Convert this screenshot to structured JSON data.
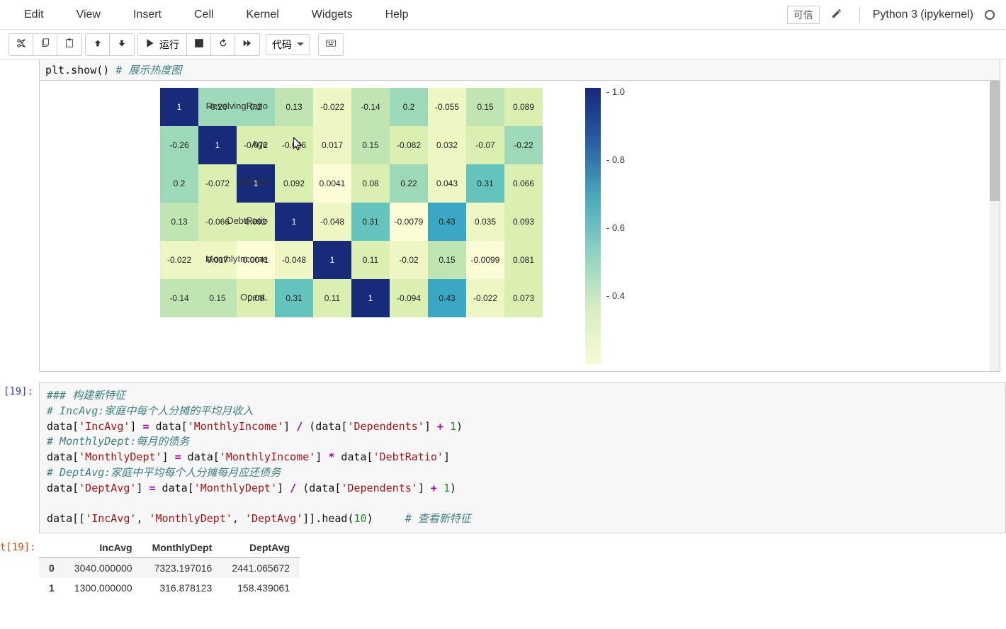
{
  "menu": {
    "edit": "Edit",
    "view": "View",
    "insert": "Insert",
    "cell": "Cell",
    "kernel": "Kernel",
    "widgets": "Widgets",
    "help": "Help",
    "trusted": "可信",
    "kernel_name": "Python 3 (ipykernel)"
  },
  "toolbar": {
    "run_label": "运行",
    "celltype_selected": "代码"
  },
  "top_cell": {
    "code_visible": "plt.show()  # 展示热度图",
    "show_fn": "plt.show",
    "parens": "()",
    "comment": "# 展示热度图"
  },
  "chart_data": {
    "type": "heatmap",
    "title": "",
    "xlabel": "",
    "ylabel": "",
    "cbar_range": [
      0,
      1
    ],
    "cbar_ticks": [
      1.0,
      0.8,
      0.6,
      0.4
    ],
    "row_labels": [
      "RevolvingRatio",
      "Age",
      "30-59D",
      "DebtRatio",
      "MonthlyIncome",
      "OpenL"
    ],
    "matrix": [
      [
        1,
        -0.26,
        0.2,
        0.13,
        -0.022,
        -0.14,
        0.2,
        -0.055,
        0.15,
        0.089
      ],
      [
        -0.26,
        1,
        -0.072,
        -0.066,
        0.017,
        0.15,
        -0.082,
        0.032,
        -0.07,
        -0.22
      ],
      [
        0.2,
        -0.072,
        1,
        0.092,
        0.0041,
        0.08,
        0.22,
        0.043,
        0.31,
        0.066
      ],
      [
        0.13,
        -0.066,
        0.092,
        1,
        -0.048,
        0.31,
        -0.0079,
        0.43,
        0.035,
        0.093
      ],
      [
        -0.022,
        0.017,
        0.0041,
        -0.048,
        1,
        0.11,
        -0.02,
        0.15,
        -0.0099,
        0.081
      ],
      [
        -0.14,
        0.15,
        0.08,
        0.31,
        0.11,
        1,
        -0.094,
        0.43,
        -0.022,
        0.073
      ]
    ],
    "fmt": [
      [
        "1",
        "-0.26",
        "0.2",
        "0.13",
        "-0.022",
        "-0.14",
        "0.2",
        "-0.055",
        "0.15",
        "0.089"
      ],
      [
        "-0.26",
        "1",
        "-0.072",
        "-0.066",
        "0.017",
        "0.15",
        "-0.082",
        "0.032",
        "-0.07",
        "-0.22"
      ],
      [
        "0.2",
        "-0.072",
        "1",
        "0.092",
        "0.0041",
        "0.08",
        "0.22",
        "0.043",
        "0.31",
        "0.066"
      ],
      [
        "0.13",
        "-0.066",
        "0.092",
        "1",
        "-0.048",
        "0.31",
        "-0.0079",
        "0.43",
        "0.035",
        "0.093"
      ],
      [
        "-0.022",
        "0.017",
        "0.0041",
        "-0.048",
        "1",
        "0.11",
        "-0.02",
        "0.15",
        "-0.0099",
        "0.081"
      ],
      [
        "-0.14",
        "0.15",
        "0.08",
        "0.31",
        "0.11",
        "1",
        "-0.094",
        "0.43",
        "-0.022",
        "0.073"
      ]
    ]
  },
  "cell19": {
    "prompt_in": "[19]:",
    "prompt_out": "t[19]:",
    "code_lines": [
      {
        "t": "comment",
        "text": "### 构建新特征"
      },
      {
        "t": "comment",
        "text": "# IncAvg:家庭中每个人分摊的平均月收入"
      },
      {
        "t": "code",
        "segments": [
          [
            "id",
            "data["
          ],
          [
            "str",
            "'IncAvg'"
          ],
          [
            "id",
            "] "
          ],
          [
            "op",
            "="
          ],
          [
            "id",
            " data["
          ],
          [
            "str",
            "'MonthlyIncome'"
          ],
          [
            "id",
            "] "
          ],
          [
            "op",
            "/"
          ],
          [
            "id",
            " (data["
          ],
          [
            "str",
            "'Dependents'"
          ],
          [
            "id",
            "] "
          ],
          [
            "op",
            "+"
          ],
          [
            "id",
            " "
          ],
          [
            "num",
            "1"
          ],
          [
            "id",
            ")"
          ]
        ]
      },
      {
        "t": "comment",
        "text": "# MonthlyDept:每月的债务"
      },
      {
        "t": "code",
        "segments": [
          [
            "id",
            "data["
          ],
          [
            "str",
            "'MonthlyDept'"
          ],
          [
            "id",
            "] "
          ],
          [
            "op",
            "="
          ],
          [
            "id",
            " data["
          ],
          [
            "str",
            "'MonthlyIncome'"
          ],
          [
            "id",
            "] "
          ],
          [
            "op",
            "*"
          ],
          [
            "id",
            " data["
          ],
          [
            "str",
            "'DebtRatio'"
          ],
          [
            "id",
            "]"
          ]
        ]
      },
      {
        "t": "comment",
        "text": "# DeptAvg:家庭中平均每个人分摊每月应还债务"
      },
      {
        "t": "code",
        "segments": [
          [
            "id",
            "data["
          ],
          [
            "str",
            "'DeptAvg'"
          ],
          [
            "id",
            "] "
          ],
          [
            "op",
            "="
          ],
          [
            "id",
            " data["
          ],
          [
            "str",
            "'MonthlyDept'"
          ],
          [
            "id",
            "] "
          ],
          [
            "op",
            "/"
          ],
          [
            "id",
            " (data["
          ],
          [
            "str",
            "'Dependents'"
          ],
          [
            "id",
            "] "
          ],
          [
            "op",
            "+"
          ],
          [
            "id",
            " "
          ],
          [
            "num",
            "1"
          ],
          [
            "id",
            ")"
          ]
        ]
      },
      {
        "t": "blank",
        "text": ""
      },
      {
        "t": "code",
        "segments": [
          [
            "id",
            "data[["
          ],
          [
            "str",
            "'IncAvg'"
          ],
          [
            "id",
            ", "
          ],
          [
            "str",
            "'MonthlyDept'"
          ],
          [
            "id",
            ", "
          ],
          [
            "str",
            "'DeptAvg'"
          ],
          [
            "id",
            "]].head("
          ],
          [
            "num",
            "10"
          ],
          [
            "id",
            ")     "
          ],
          [
            "comment",
            "# 查看新特征"
          ]
        ]
      }
    ]
  },
  "df_output": {
    "columns": [
      "IncAvg",
      "MonthlyDept",
      "DeptAvg"
    ],
    "rows": [
      {
        "idx": "0",
        "vals": [
          "3040.000000",
          "7323.197016",
          "2441.065672"
        ]
      },
      {
        "idx": "1",
        "vals": [
          "1300.000000",
          "316.878123",
          "158.439061"
        ]
      }
    ]
  }
}
